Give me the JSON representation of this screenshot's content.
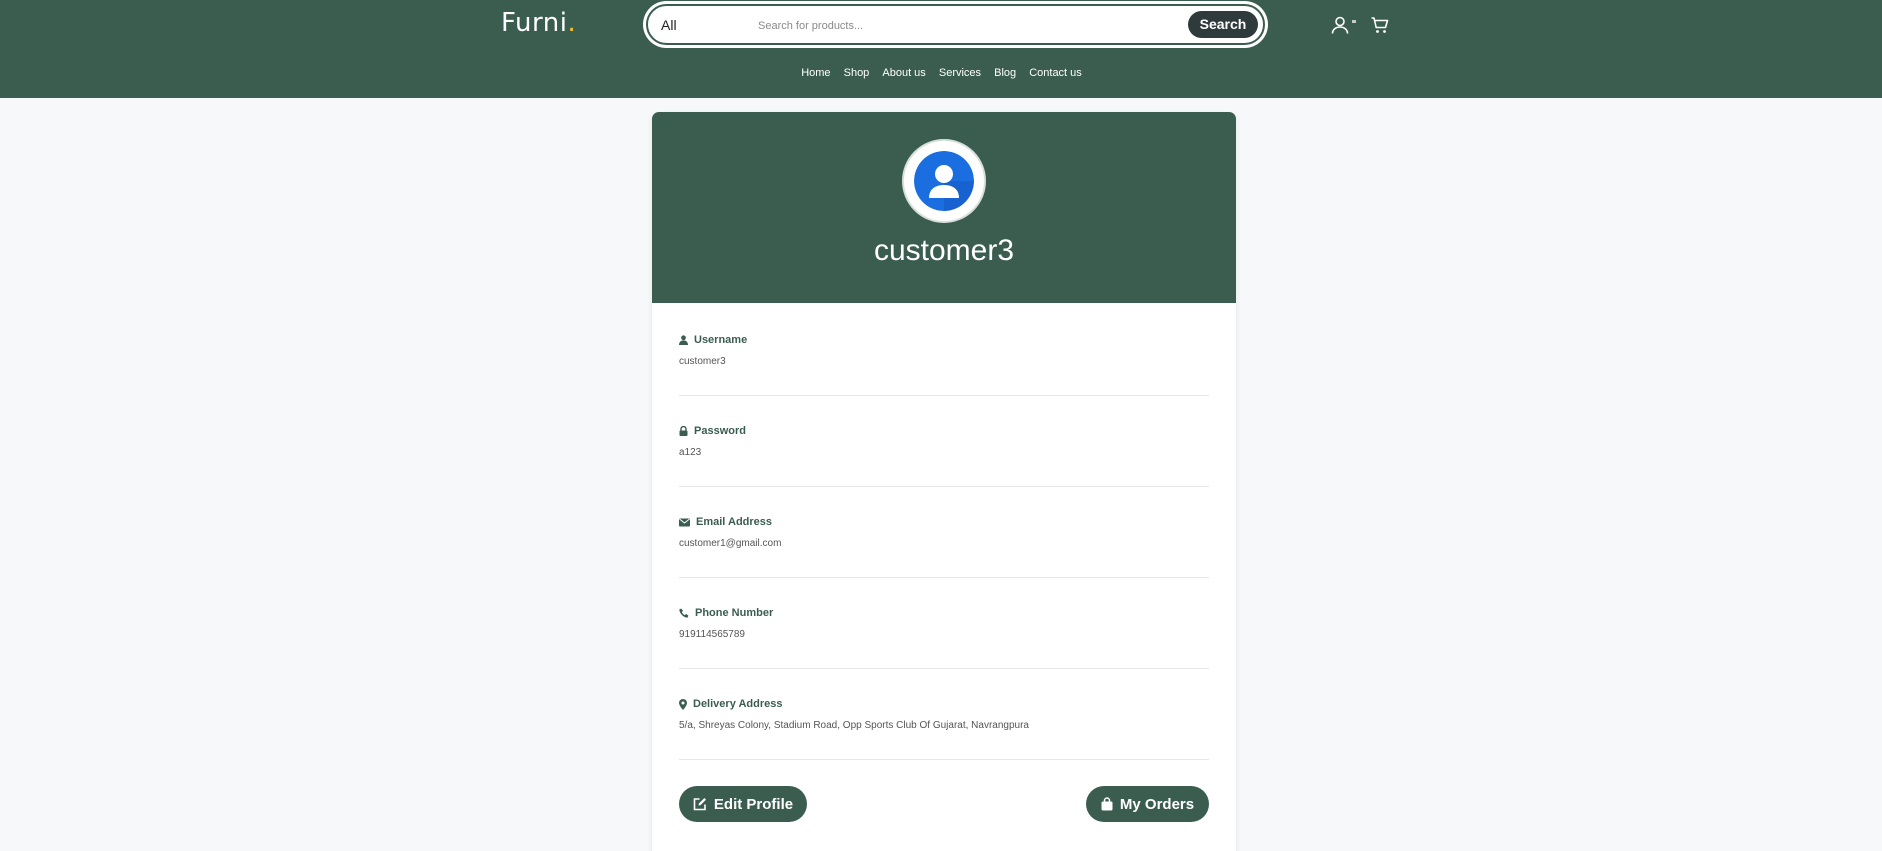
{
  "header": {
    "brand": "Furni",
    "brand_dot": ".",
    "search": {
      "category": "All",
      "placeholder": "Search for products...",
      "button_label": "Search"
    },
    "nav": [
      "Home",
      "Shop",
      "About us",
      "Services",
      "Blog",
      "Contact us"
    ]
  },
  "profile": {
    "name": "customer3",
    "fields": [
      {
        "label": "Username",
        "value": "customer3",
        "icon": "user-icon"
      },
      {
        "label": "Password",
        "value": "a123",
        "icon": "lock-icon"
      },
      {
        "label": "Email Address",
        "value": "customer1@gmail.com",
        "icon": "envelope-icon"
      },
      {
        "label": "Phone Number",
        "value": "919114565789",
        "icon": "phone-icon"
      },
      {
        "label": "Delivery Address",
        "value": "5/a, Shreyas Colony, Stadium Road, Opp Sports Club Of Gujarat, Navrangpura",
        "icon": "map-pin-icon"
      }
    ],
    "actions": {
      "edit_label": "Edit Profile",
      "orders_label": "My Orders"
    }
  },
  "colors": {
    "brand_green": "#3b5d50",
    "brand_dot": "#f9bf29",
    "search_button": "#2f3a3d",
    "page_bg": "#f6f8fa",
    "avatar_blue": "#1a6ee0"
  }
}
